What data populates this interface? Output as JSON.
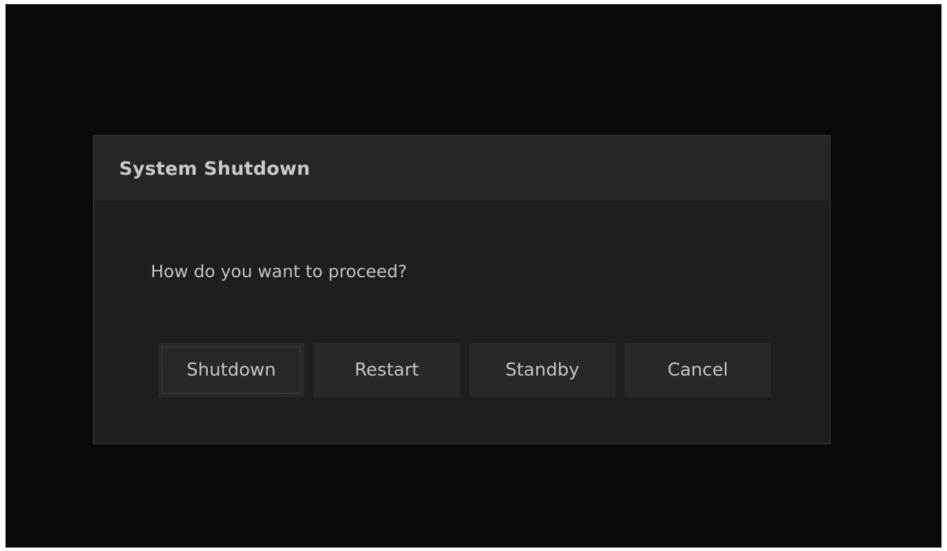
{
  "dialog": {
    "title": "System Shutdown",
    "message": "How do you want to proceed?",
    "buttons": [
      {
        "label": "Shutdown",
        "focused": true
      },
      {
        "label": "Restart"
      },
      {
        "label": "Standby"
      },
      {
        "label": "Cancel"
      }
    ]
  },
  "colors": {
    "background": "#0a0a0a",
    "dialog_body": "#1e1e20",
    "dialog_header": "#262628",
    "button": "#28282a",
    "text": "#c4c4c4"
  }
}
